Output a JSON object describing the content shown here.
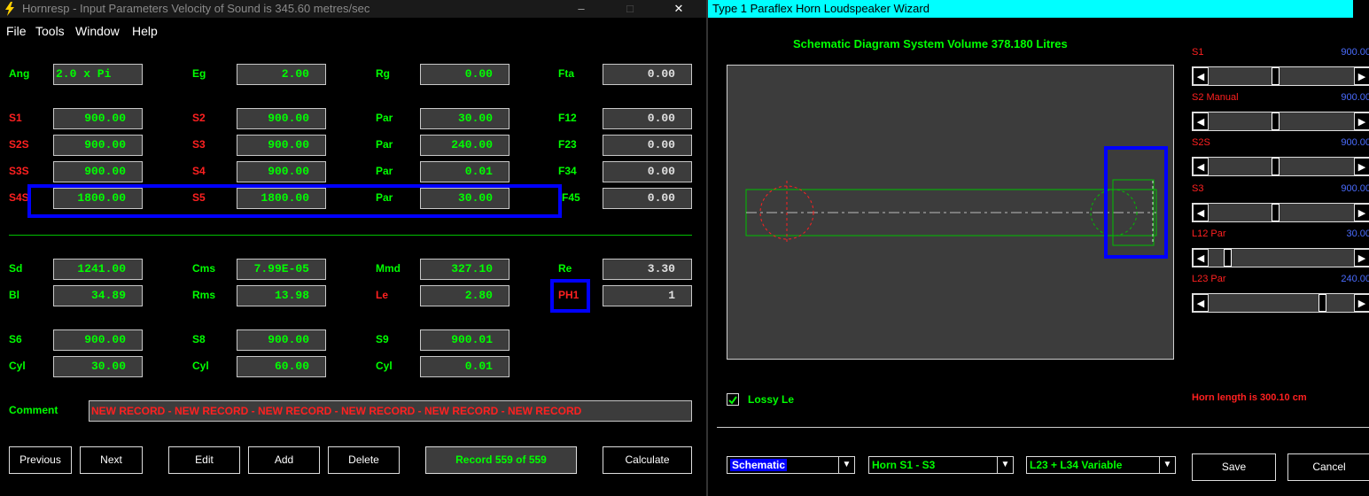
{
  "left_window": {
    "title": "Hornresp - Input Parameters   Velocity of Sound is 345.60 metres/sec",
    "controls": [
      "–",
      "□",
      "✕"
    ],
    "menu": [
      "File",
      "Tools",
      "Window",
      "Help"
    ],
    "row0": [
      {
        "label": "Ang",
        "value": "2.0 x Pi"
      },
      {
        "label": "Eg",
        "value": "2.00"
      },
      {
        "label": "Rg",
        "value": "0.00"
      },
      {
        "label": "Fta",
        "value": "0.00"
      }
    ],
    "rows1": [
      [
        {
          "label": "S1",
          "value": "900.00"
        },
        {
          "label": "S2",
          "value": "900.00"
        },
        {
          "label": "Par",
          "value": "30.00"
        },
        {
          "label": "F12",
          "value": "0.00"
        }
      ],
      [
        {
          "label": "S2S",
          "value": "900.00"
        },
        {
          "label": "S3",
          "value": "900.00"
        },
        {
          "label": "Par",
          "value": "240.00"
        },
        {
          "label": "F23",
          "value": "0.00"
        }
      ],
      [
        {
          "label": "S3S",
          "value": "900.00"
        },
        {
          "label": "S4",
          "value": "900.00"
        },
        {
          "label": "Par",
          "value": "0.01"
        },
        {
          "label": "F34",
          "value": "0.00"
        }
      ],
      [
        {
          "label": "S4S",
          "value": "1800.00"
        },
        {
          "label": "S5",
          "value": "1800.00"
        },
        {
          "label": "Par",
          "value": "30.00"
        },
        {
          "label": "F45",
          "value": "0.00"
        }
      ]
    ],
    "rows2": [
      [
        {
          "label": "Sd",
          "value": "1241.00"
        },
        {
          "label": "Cms",
          "value": "7.99E-05"
        },
        {
          "label": "Mmd",
          "value": "327.10"
        },
        {
          "label": "Re",
          "value": "3.30"
        }
      ],
      [
        {
          "label": "Bl",
          "value": "34.89"
        },
        {
          "label": "Rms",
          "value": "13.98"
        },
        {
          "label": "Le",
          "value": "2.80"
        },
        {
          "label": "PH1",
          "value": "1"
        }
      ]
    ],
    "rows3": [
      [
        {
          "label": "S6",
          "value": "900.00"
        },
        {
          "label": "S8",
          "value": "900.00"
        },
        {
          "label": "S9",
          "value": "900.01"
        }
      ],
      [
        {
          "label": "Cyl",
          "value": "30.00"
        },
        {
          "label": "Cyl",
          "value": "60.00"
        },
        {
          "label": "Cyl",
          "value": "0.01"
        }
      ]
    ],
    "comment_label": "Comment",
    "comment": "NEW RECORD - NEW RECORD - NEW RECORD - NEW RECORD - NEW RECORD - NEW RECORD",
    "buttons": {
      "previous": "Previous",
      "next": "Next",
      "edit": "Edit",
      "add": "Add",
      "delete": "Delete",
      "record": "Record 559 of 559",
      "calculate": "Calculate"
    }
  },
  "right_window": {
    "title": "Type 1 Paraflex Horn Loudspeaker Wizard",
    "heading": "Schematic Diagram   System Volume 378.180 Litres",
    "sliders": [
      {
        "label": "S1",
        "value": "900.00",
        "position": 0.46
      },
      {
        "label": "S2 Manual",
        "value": "900.00",
        "position": 0.46
      },
      {
        "label": "S2S",
        "value": "900.00",
        "position": 0.46
      },
      {
        "label": "S3",
        "value": "900.00",
        "position": 0.46
      },
      {
        "label": "L12 Par",
        "value": "30.00",
        "position": 0.11
      },
      {
        "label": "L23 Par",
        "value": "240.00",
        "position": 0.83
      }
    ],
    "lossy_le": "Lossy Le",
    "horn_length": "Horn length is 300.10 cm",
    "dropdowns": [
      "Schematic",
      "Horn S1 - S3",
      "L23 + L34 Variable"
    ],
    "save": "Save",
    "cancel": "Cancel"
  },
  "colors": {
    "label_green": "#00ff00",
    "label_red": "#ff2020",
    "highlight": "#0000ff",
    "title_cyan": "#00ffff"
  }
}
